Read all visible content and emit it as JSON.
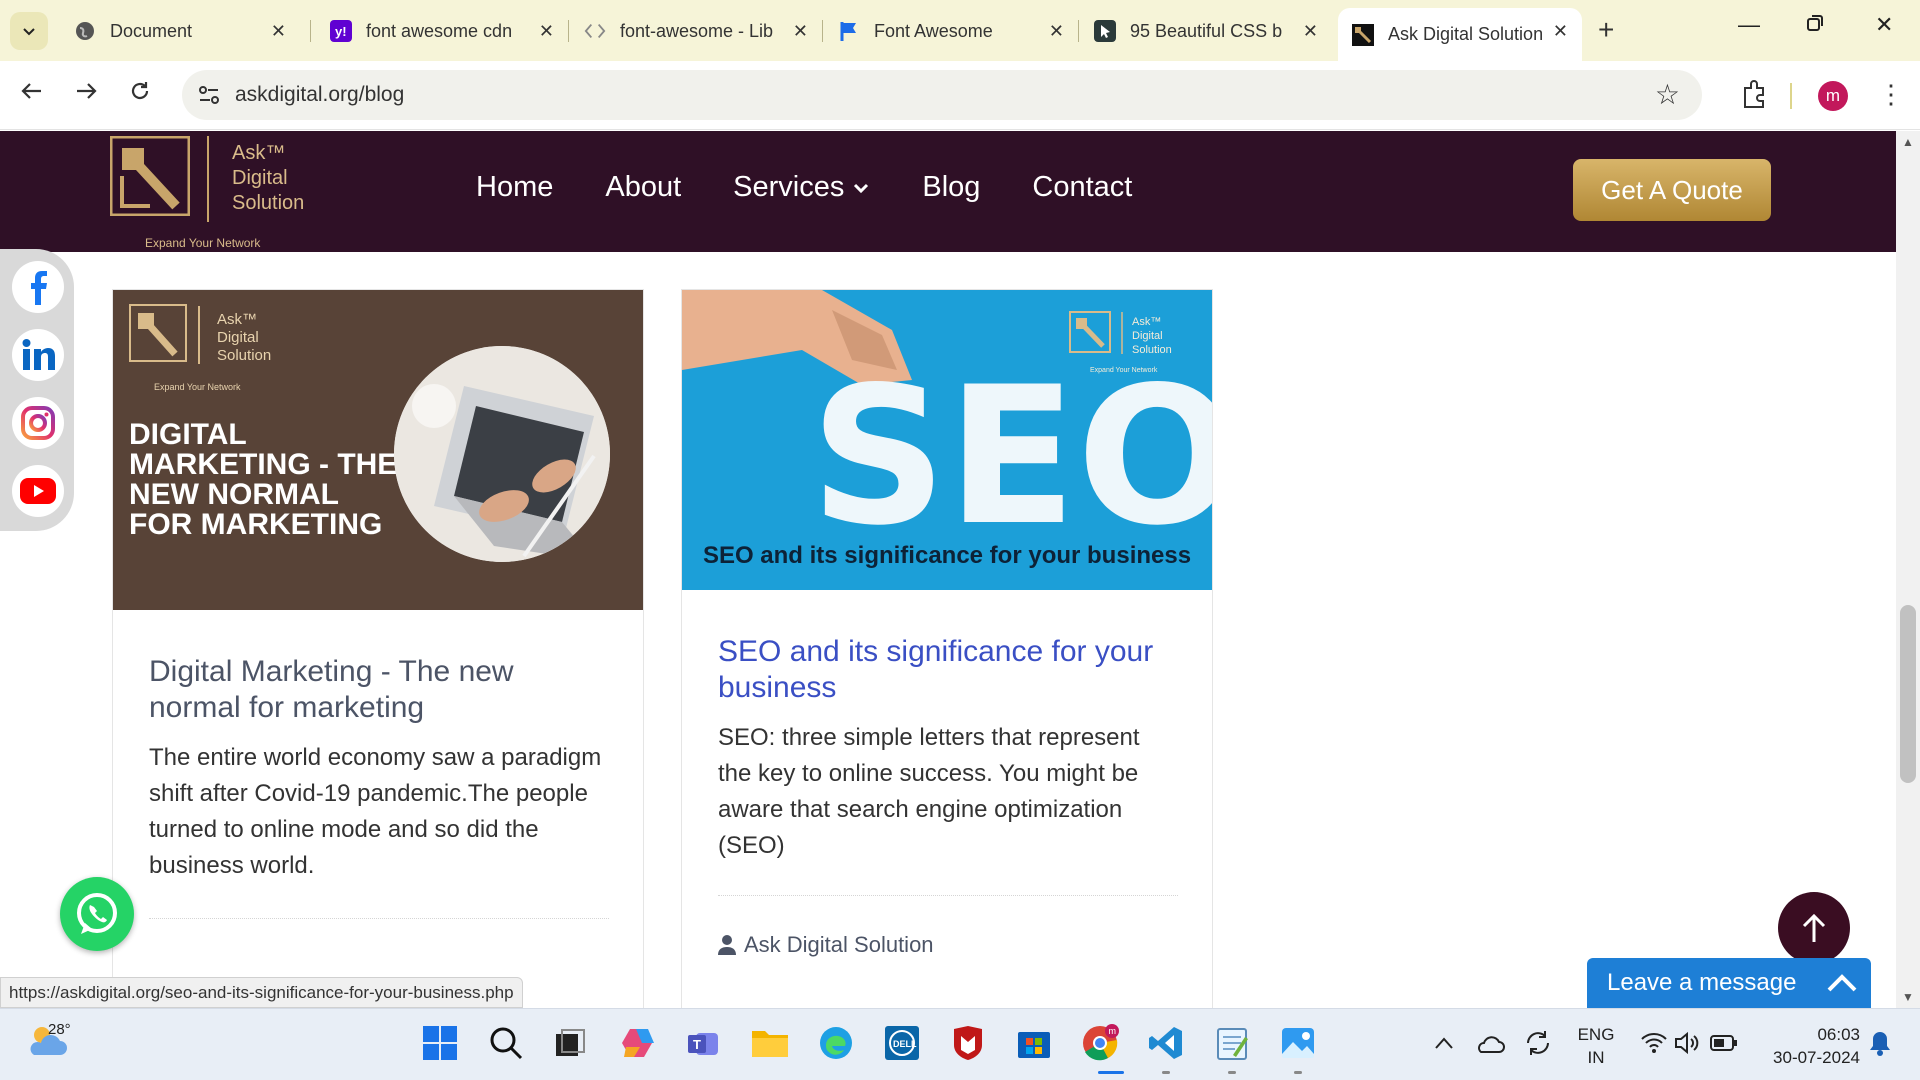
{
  "browser": {
    "tabs": [
      {
        "title": "Document",
        "icon": "globe-icon"
      },
      {
        "title": "font awesome cdn",
        "icon": "yahoo-icon"
      },
      {
        "title": "font-awesome - Lib",
        "icon": "code-icon"
      },
      {
        "title": "Font Awesome",
        "icon": "flag-icon"
      },
      {
        "title": "95 Beautiful CSS b",
        "icon": "cursor-icon"
      },
      {
        "title": "Ask Digital Solution",
        "icon": "adss-logo-icon",
        "active": true
      }
    ],
    "url": "askdigital.org/blog",
    "profile_initial": "m"
  },
  "site": {
    "logo": {
      "line1": "Ask™",
      "line2": "Digital",
      "line3": "Solution",
      "tagline": "Expand Your Network"
    },
    "nav": [
      "Home",
      "About",
      "Services",
      "Blog",
      "Contact"
    ],
    "cta": "Get A Quote"
  },
  "social": [
    "facebook-icon",
    "linkedin-icon",
    "instagram-icon",
    "youtube-icon"
  ],
  "posts": [
    {
      "image_headline": "DIGITAL MARKETING - THE NEW NORMAL FOR MARKETING",
      "title": "Digital Marketing - The new normal for marketing",
      "excerpt": "The entire world economy saw a paradigm shift after Covid-19 pandemic.The people turned to online mode and so did the business world."
    },
    {
      "image_caption": "SEO and its significance for your business",
      "image_letters": "SEO",
      "title": "SEO and its significance for your business",
      "excerpt": "SEO: three simple letters that represent the key to online success. You might be aware that search engine optimization (SEO)",
      "author": "Ask Digital Solution"
    }
  ],
  "widgets": {
    "leave_message": "Leave a message",
    "status_url": "https://askdigital.org/seo-and-its-significance-for-your-business.php"
  },
  "taskbar": {
    "weather_temp": "28°",
    "lang_line1": "ENG",
    "lang_line2": "IN",
    "time": "06:03",
    "date": "30-07-2024"
  },
  "colors": {
    "header_bg": "#2f1026",
    "gold": "#c8a56a",
    "title_grey": "#4c5466",
    "title_blue": "#3a4fc4",
    "chat_blue": "#1e7fd6"
  }
}
